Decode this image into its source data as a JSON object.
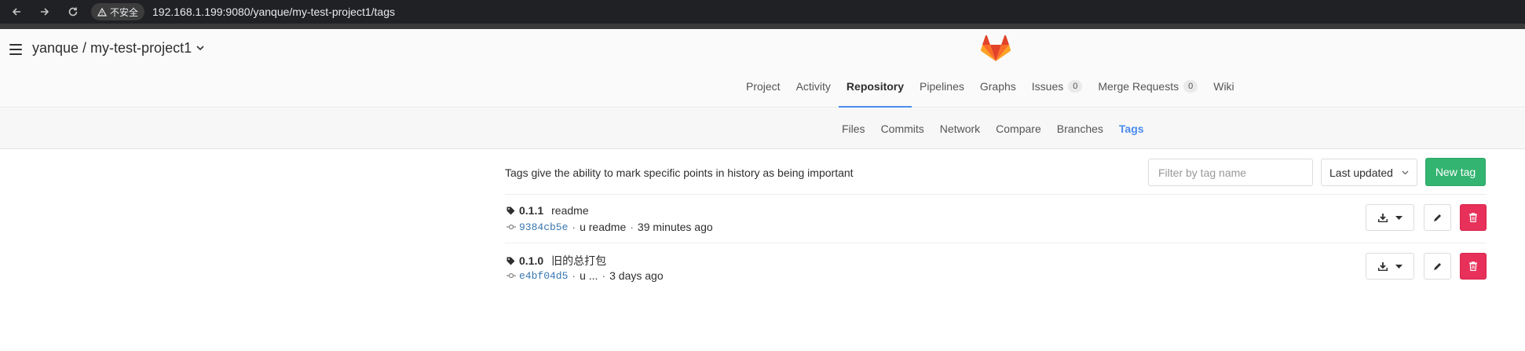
{
  "browser": {
    "back_icon": "arrow-left-icon",
    "forward_icon": "arrow-right-icon",
    "reload_icon": "reload-icon",
    "security_label": "不安全",
    "url": "192.168.1.199:9080/yanque/my-test-project1/tags"
  },
  "header": {
    "project_path": "yanque / my-test-project1",
    "main_nav": [
      {
        "label": "Project"
      },
      {
        "label": "Activity"
      },
      {
        "label": "Repository",
        "active": true
      },
      {
        "label": "Pipelines"
      },
      {
        "label": "Graphs"
      },
      {
        "label": "Issues",
        "count": "0"
      },
      {
        "label": "Merge Requests",
        "count": "0"
      },
      {
        "label": "Wiki"
      }
    ]
  },
  "sub_nav": [
    {
      "label": "Files"
    },
    {
      "label": "Commits"
    },
    {
      "label": "Network"
    },
    {
      "label": "Compare"
    },
    {
      "label": "Branches"
    },
    {
      "label": "Tags",
      "active": true
    }
  ],
  "tags_page": {
    "description": "Tags give the ability to mark specific points in history as being important",
    "filter_placeholder": "Filter by tag name",
    "sort_label": "Last updated",
    "new_tag_label": "New tag",
    "tags": [
      {
        "name": "0.1.1",
        "message": "readme",
        "sha": "9384cb5e",
        "commit_text": "u readme",
        "time": "39 minutes ago"
      },
      {
        "name": "0.1.0",
        "message": "旧的总打包",
        "sha": "e4bf04d5",
        "commit_text": "u ...",
        "time": "3 days ago"
      }
    ]
  },
  "colors": {
    "accent": "#4a8bee",
    "success": "#33b470",
    "danger": "#e7315a",
    "link": "#3777b0"
  }
}
